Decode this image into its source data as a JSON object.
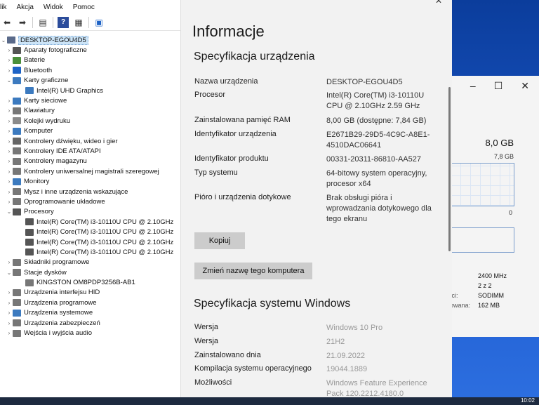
{
  "device_manager": {
    "menu": [
      "lik",
      "Akcja",
      "Widok",
      "Pomoc"
    ],
    "toolbar_icons": [
      "back-arrow-icon",
      "forward-arrow-icon",
      "properties-icon",
      "help-icon",
      "view-icon",
      "monitor-icon"
    ],
    "tree": [
      {
        "level": 0,
        "label": "DESKTOP-EGOU4D5",
        "expander": "v",
        "icon_color": "#5a6a8a",
        "selected": true
      },
      {
        "level": 1,
        "label": "Aparaty fotograficzne",
        "expander": ">",
        "icon_color": "#555555"
      },
      {
        "level": 1,
        "label": "Baterie",
        "expander": ">",
        "icon_color": "#4a8f3b"
      },
      {
        "level": 1,
        "label": "Bluetooth",
        "expander": ">",
        "icon_color": "#1e63c6"
      },
      {
        "level": 1,
        "label": "Karty graficzne",
        "expander": "v",
        "icon_color": "#3c7abf"
      },
      {
        "level": 2,
        "label": "Intel(R) UHD Graphics",
        "expander": "",
        "icon_color": "#3c7abf"
      },
      {
        "level": 1,
        "label": "Karty sieciowe",
        "expander": ">",
        "icon_color": "#3c7abf"
      },
      {
        "level": 1,
        "label": "Klawiatury",
        "expander": ">",
        "icon_color": "#777777"
      },
      {
        "level": 1,
        "label": "Kolejki wydruku",
        "expander": ">",
        "icon_color": "#8a8a8a"
      },
      {
        "level": 1,
        "label": "Komputer",
        "expander": ">",
        "icon_color": "#3c7abf"
      },
      {
        "level": 1,
        "label": "Kontrolery dźwięku, wideo i gier",
        "expander": ">",
        "icon_color": "#666666"
      },
      {
        "level": 1,
        "label": "Kontrolery IDE ATA/ATAPI",
        "expander": ">",
        "icon_color": "#777777"
      },
      {
        "level": 1,
        "label": "Kontrolery magazynu",
        "expander": ">",
        "icon_color": "#777777"
      },
      {
        "level": 1,
        "label": "Kontrolery uniwersalnej magistrali szeregowej",
        "expander": ">",
        "icon_color": "#777777"
      },
      {
        "level": 1,
        "label": "Monitory",
        "expander": ">",
        "icon_color": "#3c7abf"
      },
      {
        "level": 1,
        "label": "Mysz i inne urządzenia wskazujące",
        "expander": ">",
        "icon_color": "#777777"
      },
      {
        "level": 1,
        "label": "Oprogramowanie układowe",
        "expander": ">",
        "icon_color": "#777777"
      },
      {
        "level": 1,
        "label": "Procesory",
        "expander": "v",
        "icon_color": "#555555"
      },
      {
        "level": 2,
        "label": "Intel(R) Core(TM) i3-10110U CPU @ 2.10GHz",
        "expander": "",
        "icon_color": "#555555"
      },
      {
        "level": 2,
        "label": "Intel(R) Core(TM) i3-10110U CPU @ 2.10GHz",
        "expander": "",
        "icon_color": "#555555"
      },
      {
        "level": 2,
        "label": "Intel(R) Core(TM) i3-10110U CPU @ 2.10GHz",
        "expander": "",
        "icon_color": "#555555"
      },
      {
        "level": 2,
        "label": "Intel(R) Core(TM) i3-10110U CPU @ 2.10GHz",
        "expander": "",
        "icon_color": "#555555"
      },
      {
        "level": 1,
        "label": "Składniki programowe",
        "expander": ">",
        "icon_color": "#777777"
      },
      {
        "level": 1,
        "label": "Stacje dysków",
        "expander": "v",
        "icon_color": "#777777"
      },
      {
        "level": 2,
        "label": "KINGSTON OM8PDP3256B-AB1",
        "expander": "",
        "icon_color": "#777777"
      },
      {
        "level": 1,
        "label": "Urządzenia interfejsu HID",
        "expander": ">",
        "icon_color": "#777777"
      },
      {
        "level": 1,
        "label": "Urządzenia programowe",
        "expander": ">",
        "icon_color": "#777777"
      },
      {
        "level": 1,
        "label": "Urządzenia systemowe",
        "expander": ">",
        "icon_color": "#3c7abf"
      },
      {
        "level": 1,
        "label": "Urządzenia zabezpieczeń",
        "expander": ">",
        "icon_color": "#777777"
      },
      {
        "level": 1,
        "label": "Wejścia i wyjścia audio",
        "expander": ">",
        "icon_color": "#777777"
      }
    ]
  },
  "settings": {
    "close_glyph": "✕",
    "title": "Informacje",
    "device_spec_heading": "Specyfikacja urządzenia",
    "device_spec": [
      {
        "key": "Nazwa urządzenia",
        "value": "DESKTOP-EGOU4D5"
      },
      {
        "key": "Procesor",
        "value": "Intel(R) Core(TM) i3-10110U CPU @ 2.10GHz   2.59 GHz"
      },
      {
        "key": "Zainstalowana pamięć RAM",
        "value": "8,00 GB (dostępne: 7,84 GB)"
      },
      {
        "key": "Identyfikator urządzenia",
        "value": "E2671B29-29D5-4C9C-A8E1-4510DAC06641"
      },
      {
        "key": "Identyfikator produktu",
        "value": "00331-20311-86810-AA527"
      },
      {
        "key": "Typ systemu",
        "value": "64-bitowy system operacyjny, procesor x64"
      },
      {
        "key": "Pióro i urządzenia dotykowe",
        "value": "Brak obsługi pióra i wprowadzania dotykowego dla tego ekranu"
      }
    ],
    "copy_button": "Kopiuj",
    "rename_button": "Zmień nazwę tego komputera",
    "windows_spec_heading": "Specyfikacja systemu Windows",
    "windows_spec": [
      {
        "key": "Wersja",
        "value": "Windows 10 Pro"
      },
      {
        "key": "Wersja",
        "value": "21H2"
      },
      {
        "key": "Zainstalowano dnia",
        "value": "21.09.2022"
      },
      {
        "key": "Kompilacja systemu operacyjnego",
        "value": "19044.1889"
      },
      {
        "key": "Możliwości",
        "value": "Windows Feature Experience Pack 120.2212.4180.0"
      }
    ]
  },
  "task_manager": {
    "controls": [
      "–",
      "☐",
      "✕"
    ],
    "memory_total": "8,0 GB",
    "memory_graph_max": "7,8 GB",
    "graph_zero": "0",
    "stats": [
      {
        "key": "",
        "value": "2400 MHz"
      },
      {
        "key": "",
        "value": "2 z 2"
      },
      {
        "key": "ıci:",
        "value": "SODIMM"
      },
      {
        "key": "owana:",
        "value": "162 MB"
      }
    ]
  },
  "taskbar": {
    "clock": "10:02"
  }
}
